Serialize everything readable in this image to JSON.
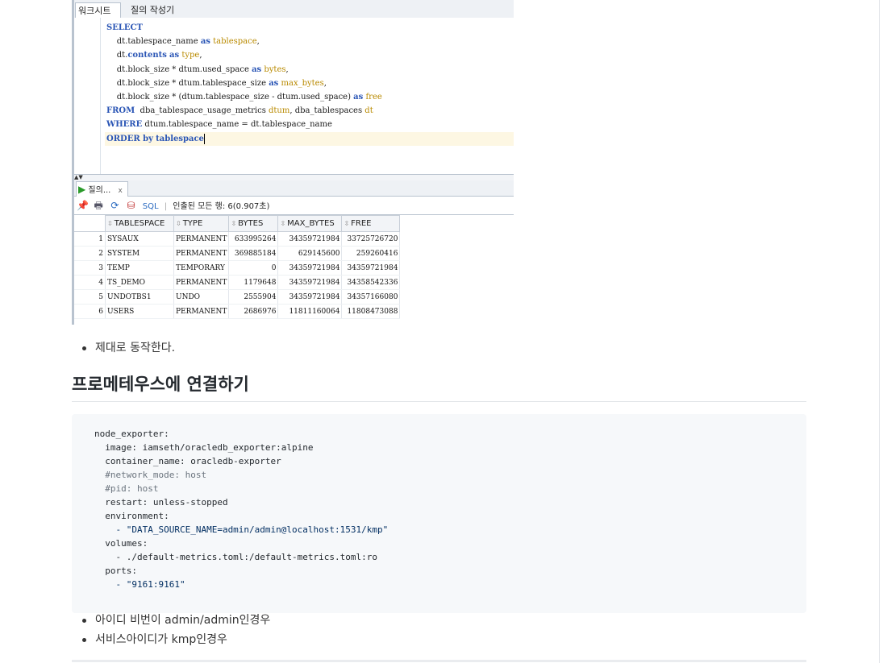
{
  "sql_developer": {
    "tabs": [
      "워크시트",
      "질의 작성기"
    ],
    "code_lines": [
      [
        {
          "t": "SELECT",
          "c": "kw"
        }
      ],
      [
        {
          "t": "    dt.tablespace_name "
        },
        {
          "t": "as",
          "c": "kw"
        },
        {
          "t": " "
        },
        {
          "t": "tablespace",
          "c": "al"
        },
        {
          "t": ","
        }
      ],
      [
        {
          "t": "    dt."
        },
        {
          "t": "contents",
          "c": "kw"
        },
        {
          "t": " "
        },
        {
          "t": "as",
          "c": "kw"
        },
        {
          "t": " "
        },
        {
          "t": "type",
          "c": "al"
        },
        {
          "t": ","
        }
      ],
      [
        {
          "t": "    dt.block_size * dtum.used_space "
        },
        {
          "t": "as",
          "c": "kw"
        },
        {
          "t": " "
        },
        {
          "t": "bytes",
          "c": "al"
        },
        {
          "t": ","
        }
      ],
      [
        {
          "t": "    dt.block_size * dtum.tablespace_size "
        },
        {
          "t": "as",
          "c": "kw"
        },
        {
          "t": " "
        },
        {
          "t": "max_bytes",
          "c": "al"
        },
        {
          "t": ","
        }
      ],
      [
        {
          "t": "    dt.block_size * (dtum.tablespace_size - dtum.used_space) "
        },
        {
          "t": "as",
          "c": "kw"
        },
        {
          "t": " "
        },
        {
          "t": "free",
          "c": "al"
        }
      ],
      [
        {
          "t": "FROM",
          "c": "kw"
        },
        {
          "t": "  dba_tablespace_usage_metrics "
        },
        {
          "t": "dtum",
          "c": "al"
        },
        {
          "t": ", dba_tablespaces "
        },
        {
          "t": "dt",
          "c": "al"
        }
      ],
      [
        {
          "t": "WHERE",
          "c": "kw"
        },
        {
          "t": " dtum.tablespace_name = dt.tablespace_name"
        }
      ],
      [
        {
          "t": "ORDER by",
          "c": "kw"
        },
        {
          "t": " "
        },
        {
          "t": "tablespace",
          "c": "kw"
        }
      ]
    ],
    "result_tab": "질의...",
    "result_tab_close": "x",
    "toolbar": {
      "sql_label": "SQL",
      "separator": "|",
      "status": "인출된 모든 행: 6(0.907초)"
    },
    "columns": [
      "TABLESPACE",
      "TYPE",
      "BYTES",
      "MAX_BYTES",
      "FREE"
    ],
    "rows": [
      [
        "1",
        "SYSAUX",
        "PERMANENT",
        "633995264",
        "34359721984",
        "33725726720"
      ],
      [
        "2",
        "SYSTEM",
        "PERMANENT",
        "369885184",
        "629145600",
        "259260416"
      ],
      [
        "3",
        "TEMP",
        "TEMPORARY",
        "0",
        "34359721984",
        "34359721984"
      ],
      [
        "4",
        "TS_DEMO",
        "PERMANENT",
        "1179648",
        "34359721984",
        "34358542336"
      ],
      [
        "5",
        "UNDOTBS1",
        "UNDO",
        "2555904",
        "34359721984",
        "34357166080"
      ],
      [
        "6",
        "USERS",
        "PERMANENT",
        "2686976",
        "11811160064",
        "11808473088"
      ]
    ]
  },
  "article": {
    "bullet_1": "제대로 동작한다.",
    "heading": "프로메테우스에 연결하기",
    "code_lines": [
      {
        "t": "node_exporter:"
      },
      {
        "t": "  image: iamseth/oracledb_exporter:alpine"
      },
      {
        "t": "  container_name: oracledb-exporter"
      },
      {
        "t": "  #network_mode: host",
        "c": "comment"
      },
      {
        "t": "  #pid: host",
        "c": "comment"
      },
      {
        "t": "  restart: unless-stopped"
      },
      {
        "t": "  environment:"
      },
      {
        "t": "    - \"DATA_SOURCE_NAME=admin/admin@localhost:1531/kmp\"",
        "c": "string"
      },
      {
        "t": "  volumes:"
      },
      {
        "t": "    - ./default-metrics.toml:/default-metrics.toml:ro"
      },
      {
        "t": "  ports:"
      },
      {
        "t": "    - \"9161:9161\"",
        "c": "string"
      }
    ],
    "bullets_2": [
      "아이디 비번이 admin/admin인경우",
      "서비스아이디가 kmp인경우"
    ]
  }
}
